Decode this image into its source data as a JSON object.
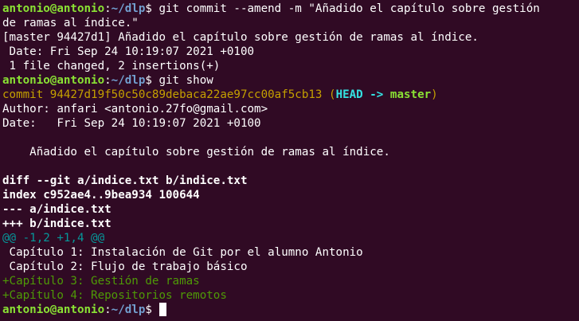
{
  "prompt": {
    "user_host": "antonio@antonio",
    "sep": ":",
    "path": "~/dlp",
    "symbol": "$"
  },
  "lines": {
    "cmd1_part1": " git commit --amend -m \"Añadido el capítulo sobre gestión",
    "cmd1_part2": "de ramas al índice.\"",
    "result1": "[master 94427d1] Añadido el capítulo sobre gestión de ramas al índice.",
    "result2": " Date: Fri Sep 24 10:19:07 2021 +0100",
    "result3": " 1 file changed, 2 insertions(+)",
    "cmd2": " git show",
    "commit_label": "commit 94427d19f50c50c89debaca22ae97cc00af5cb13",
    "paren_open": " (",
    "head": "HEAD -> ",
    "master": "master",
    "paren_close": ")",
    "author": "Author: anfari <antonio.27fo@gmail.com>",
    "date": "Date:   Fri Sep 24 10:19:07 2021 +0100",
    "message": "    Añadido el capítulo sobre gestión de ramas al índice.",
    "diff_header": "diff --git a/indice.txt b/indice.txt",
    "index_line": "index c952ae4..9bea934 100644",
    "minus_file": "--- a/indice.txt",
    "plus_file": "+++ b/indice.txt",
    "hunk": "@@ -1,2 +1,4 @@",
    "ctx1": " Capítulo 1: Instalación de Git por el alumno Antonio",
    "ctx2": " Capítulo 2: Flujo de trabajo básico",
    "add1": "+Capítulo 3: Gestión de ramas",
    "add2": "+Capítulo 4: Repositorios remotos",
    "final_cmd": " "
  },
  "colors": {
    "background": "#300a24",
    "foreground": "#ffffff",
    "prompt_user": "#8ae234",
    "prompt_path": "#729fcf",
    "commit_hash": "#c4a000",
    "head_ref": "#34e2e2",
    "diff_hunk": "#06989a",
    "diff_added": "#4e9a06"
  }
}
